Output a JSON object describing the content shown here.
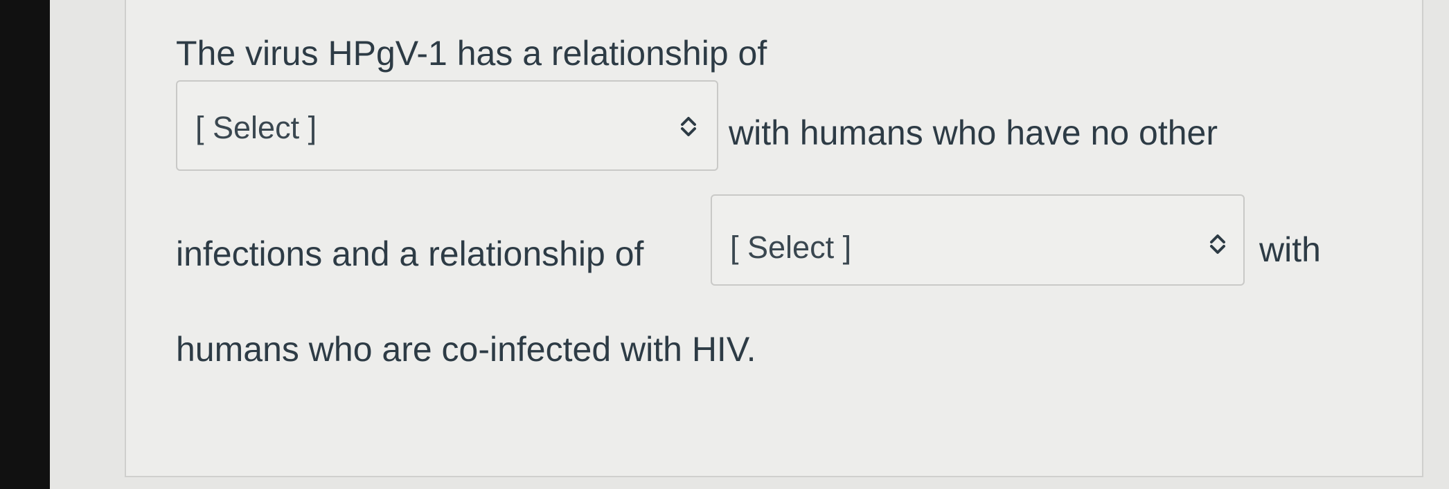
{
  "question": {
    "line1": "The virus HPgV-1 has a relationship of",
    "after_select1": "with humans who have no other",
    "before_select2": "infections and a relationship of",
    "after_select2": "with",
    "line4": "humans who are co-infected with HIV."
  },
  "selects": [
    {
      "value": "[ Select ]",
      "icon": "updown-chevron-icon"
    },
    {
      "value": "[ Select ]",
      "icon": "updown-chevron-icon"
    }
  ]
}
